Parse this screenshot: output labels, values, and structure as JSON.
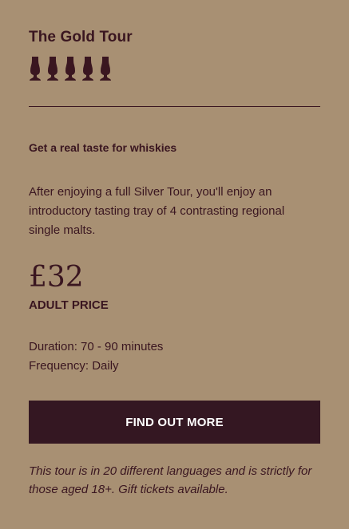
{
  "tour": {
    "title": "The Gold Tour",
    "rating_icons": [
      "whisky-glass-icon",
      "whisky-glass-icon",
      "whisky-glass-icon",
      "whisky-glass-icon",
      "whisky-glass-icon"
    ],
    "rating": 5,
    "subtitle": "Get a real taste for whiskies",
    "description": "After enjoying a full Silver Tour, you'll enjoy an introductory tasting tray of 4 contrasting regional single malts.",
    "price": "£32",
    "price_label": "ADULT PRICE",
    "duration": "Duration: 70 - 90 minutes",
    "frequency": "Frequency: Daily",
    "button_label": "FIND OUT MORE",
    "note": "This tour is in 20 different languages and is strictly for those aged 18+. Gift tickets available."
  },
  "colors": {
    "background": "#a89073",
    "text": "#3a1620",
    "button": "#341722",
    "button_text": "#ffffff"
  }
}
